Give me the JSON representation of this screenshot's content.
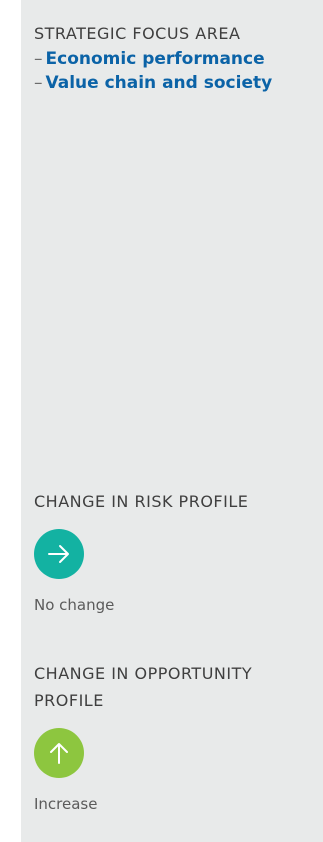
{
  "strategic_focus": {
    "heading": "STRATEGIC FOCUS AREA",
    "items": [
      "Economic performance",
      "Value chain and society"
    ]
  },
  "risk_profile": {
    "heading": "CHANGE IN RISK PROFILE",
    "icon": "arrow-right-icon",
    "icon_color": "#13b2a2",
    "status": "No change"
  },
  "opportunity_profile": {
    "heading_line1": "CHANGE IN OPPORTUNITY",
    "heading_line2": "PROFILE",
    "icon": "arrow-up-icon",
    "icon_color": "#8dc63f",
    "status": "Increase"
  },
  "colors": {
    "panel_background": "#e8eaea",
    "focus_item": "#0b63a7",
    "heading": "#3f3f3f"
  }
}
